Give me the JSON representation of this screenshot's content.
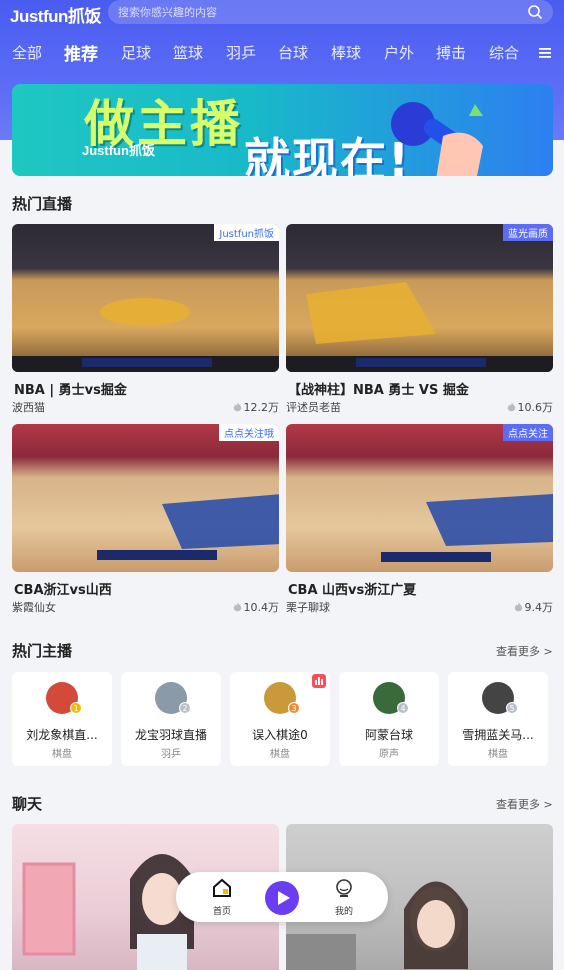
{
  "header": {
    "logo_text": "Justfun抓饭",
    "search_placeholder": "搜索你感兴趣的内容",
    "tabs": [
      "全部",
      "推荐",
      "足球",
      "篮球",
      "羽乒",
      "台球",
      "棒球",
      "户外",
      "搏击",
      "综合"
    ],
    "active_tab": "推荐",
    "menu_icon": "menu-icon",
    "search_icon": "search-icon"
  },
  "banner": {
    "line1": "做主播",
    "line2": "就现在!",
    "logo": "Justfun抓饭"
  },
  "hot_live": {
    "title": "热门直播",
    "cards": [
      {
        "title": "NBA | 勇士vs掘金",
        "author": "波西猫",
        "views": "12.2万",
        "tag": "Justfun抓饭"
      },
      {
        "title": "【战神柱】NBA 勇士 VS 掘金",
        "author": "评述员老苗",
        "views": "10.6万",
        "tag": "蓝光画质"
      },
      {
        "title": "CBA浙江vs山西",
        "author": "紫霞仙女",
        "views": "10.4万",
        "tag": "点点关注哦"
      },
      {
        "title": "CBA 山西vs浙江广夏",
        "author": "栗子聊球",
        "views": "9.4万",
        "tag": "点点关注"
      }
    ]
  },
  "hot_streamers": {
    "title": "热门主播",
    "more": "查看更多 >",
    "items": [
      {
        "name": "刘龙象棋直...",
        "category": "棋盘",
        "rank": "1",
        "rank_color": "#f5b800"
      },
      {
        "name": "龙宝羽球直播",
        "category": "羽乒",
        "rank": "2",
        "rank_color": "#b9bec9"
      },
      {
        "name": "误入棋途0",
        "category": "棋盘",
        "rank": "3",
        "rank_color": "#f08a3c"
      },
      {
        "name": "阿蒙台球",
        "category": "原声",
        "rank": "4",
        "rank_color": "#b9bec9"
      },
      {
        "name": "雪拥蓝关马...",
        "category": "棋盘",
        "rank": "5",
        "rank_color": "#b9bec9"
      }
    ]
  },
  "chat": {
    "title": "聊天",
    "more": "查看更多 >"
  },
  "bottom_nav": {
    "home": "首页",
    "mine": "我的"
  },
  "colors": {
    "brand": "#5b6cf6",
    "play": "#6b3df2"
  }
}
